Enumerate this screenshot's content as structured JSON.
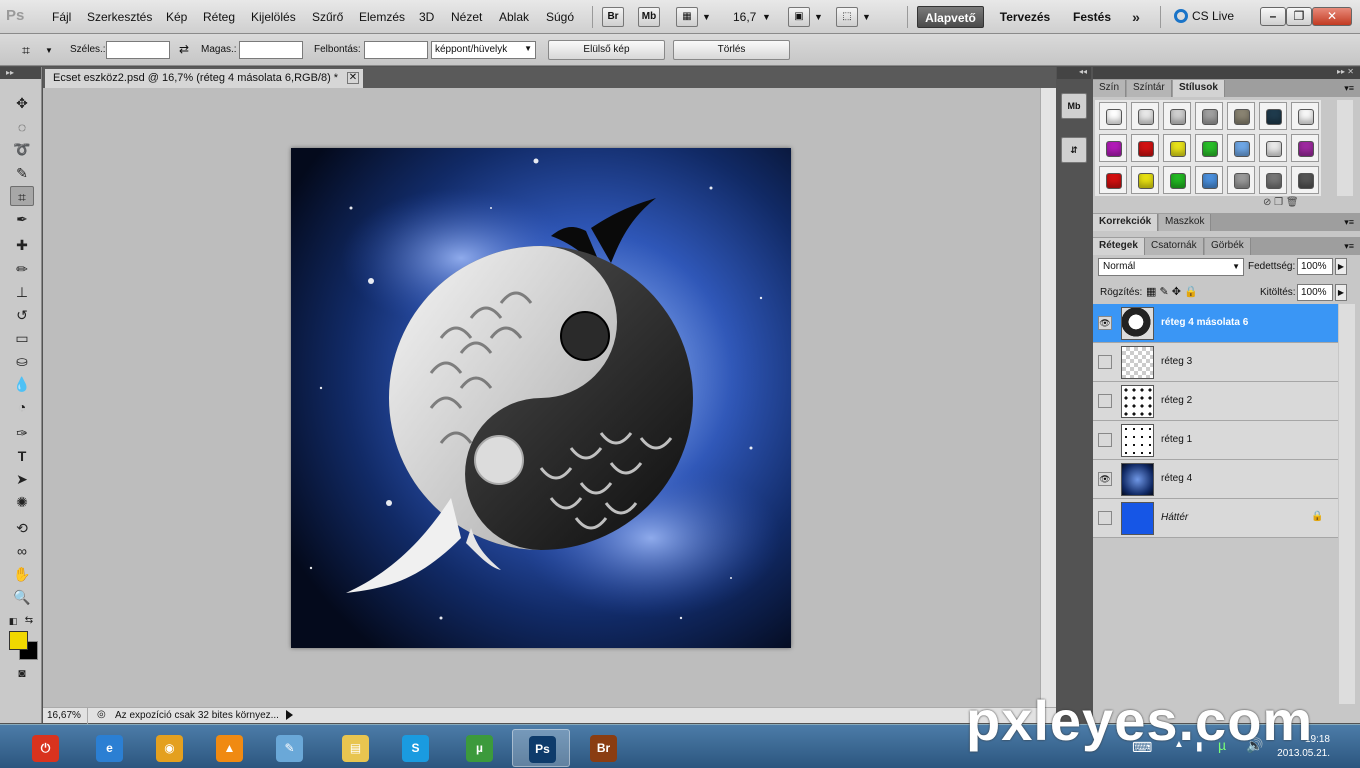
{
  "menu": {
    "logo": "Ps",
    "items": [
      "Fájl",
      "Szerkesztés",
      "Kép",
      "Réteg",
      "Kijelölés",
      "Szűrő",
      "Elemzés",
      "3D",
      "Nézet",
      "Ablak",
      "Súgó"
    ],
    "bridge_label": "Br",
    "minibridge_label": "Mb",
    "zoom": "16,7",
    "workspaces": {
      "active": "Alapvető",
      "second": "Tervezés",
      "third": "Festés",
      "more": "»"
    },
    "cs_live": "CS Live"
  },
  "options": {
    "width_label": "Széles.:",
    "width_value": "",
    "height_label": "Magas.:",
    "height_value": "",
    "resolution_label": "Felbontás:",
    "resolution_value": "",
    "unit_select": "képpont/hüvelyk",
    "front_image_button": "Elülső kép",
    "clear_button": "Törlés"
  },
  "document": {
    "tab_title": "Ecset eszköz2.psd @ 16,7% (réteg 4 másolata 6,RGB/8) *",
    "status_zoom": "16,67%",
    "status_text": "Az expozíció csak 32 bites környez..."
  },
  "panels": {
    "top_tabs": [
      "Szín",
      "Színtár",
      "Stílusok"
    ],
    "top_active": "Stílusok",
    "adjust_tabs": [
      "Korrekciók",
      "Maszkok"
    ],
    "layer_tabs": [
      "Rétegek",
      "Csatornák",
      "Görbék"
    ],
    "layer_active": "Rétegek",
    "blend_mode": "Normál",
    "opacity_label": "Fedettség:",
    "opacity_value": "100%",
    "lock_label": "Rögzítés:",
    "fill_label": "Kitöltés:",
    "fill_value": "100%",
    "style_colors": [
      "#ffffff",
      "#e8e8e8",
      "#cfcfcf",
      "#a0a0a0",
      "#8a8472",
      "#1f3b4d",
      "#f7f7f7",
      "#b21bb8",
      "#d21111",
      "#e8e21a",
      "#2bbf2b",
      "#6fa7e6",
      "#e9e9e9",
      "#9e2aa0",
      "#d30f0f",
      "#e6df12",
      "#22b822",
      "#4a8fdc",
      "#9a9a9a",
      "#777777",
      "#555555"
    ],
    "layers": [
      {
        "name": "réteg 4 másolata 6",
        "visible": true,
        "selected": true,
        "thumb": "yinyang-fish"
      },
      {
        "name": "réteg 3",
        "visible": false,
        "selected": false,
        "thumb": "transparent"
      },
      {
        "name": "réteg 2",
        "visible": false,
        "selected": false,
        "thumb": "yinyang-small"
      },
      {
        "name": "réteg 1",
        "visible": false,
        "selected": false,
        "thumb": "yinyang-outline"
      },
      {
        "name": "réteg 4",
        "visible": true,
        "selected": false,
        "thumb": "space"
      },
      {
        "name": "Háttér",
        "visible": false,
        "selected": false,
        "thumb": "blue-fill",
        "locked": true
      }
    ]
  },
  "taskbar": {
    "apps": [
      "power",
      "internet-explorer",
      "chrome",
      "vlc",
      "notepad",
      "explorer",
      "skype",
      "utorrent",
      "photoshop",
      "bridge"
    ],
    "active_app": "photoshop",
    "time": "19:18",
    "date": "2013.05.21."
  },
  "watermark": "pxleyes.com",
  "colors": {
    "accent": "#3a96f5",
    "foreground": "#f0d800",
    "background": "#000000"
  }
}
